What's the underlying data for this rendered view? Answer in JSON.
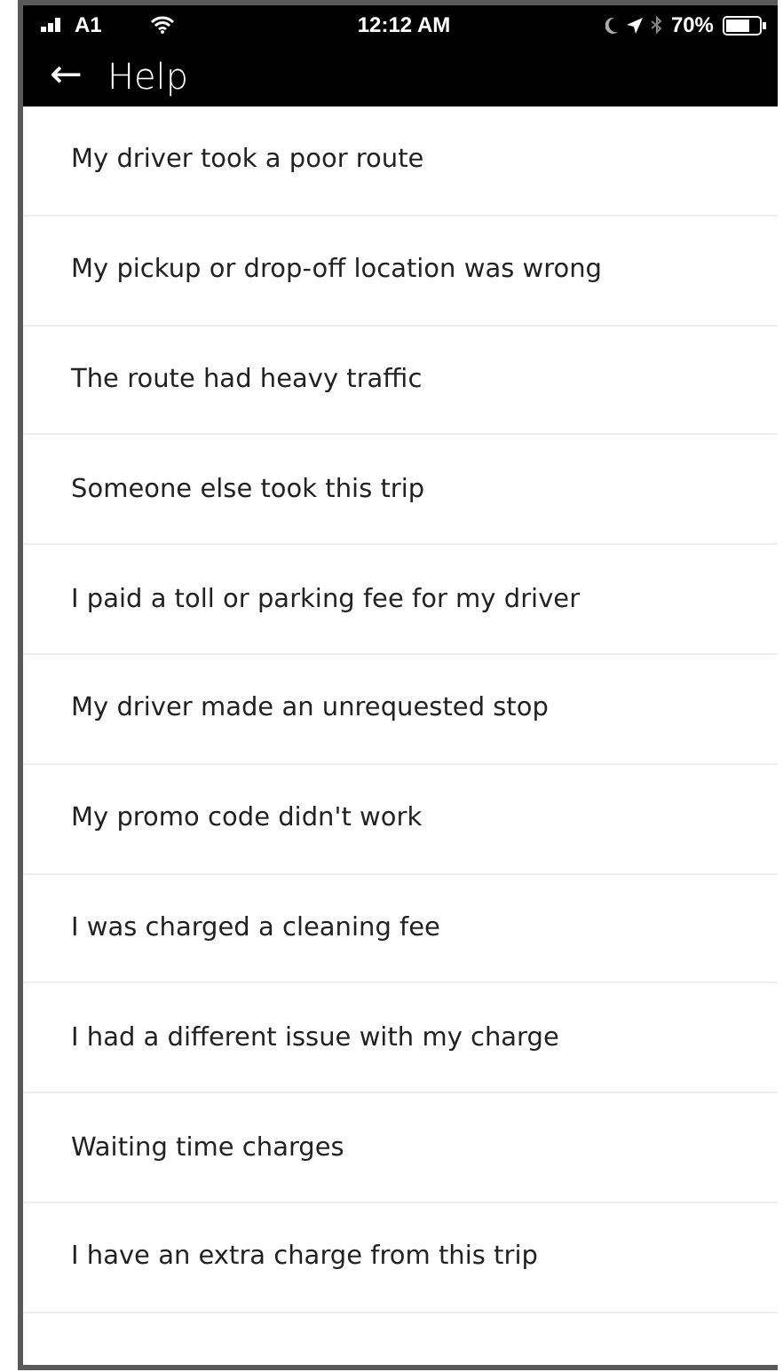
{
  "status_bar": {
    "carrier": "A1",
    "time": "12:12 AM",
    "battery": "70%"
  },
  "header": {
    "back": "←",
    "title": "Help"
  },
  "items": [
    {
      "label": "My driver took a poor route"
    },
    {
      "label": "My pickup or drop-off location was wrong"
    },
    {
      "label": "The route had heavy traffic"
    },
    {
      "label": "Someone else took this trip"
    },
    {
      "label": "I paid a toll or parking fee for my driver"
    },
    {
      "label": "My driver made an unrequested stop"
    },
    {
      "label": "My promo code didn't work"
    },
    {
      "label": "I was charged a cleaning fee"
    },
    {
      "label": "I had a different issue with my charge"
    },
    {
      "label": "Waiting time charges"
    },
    {
      "label": "I have an extra charge from this trip"
    }
  ]
}
